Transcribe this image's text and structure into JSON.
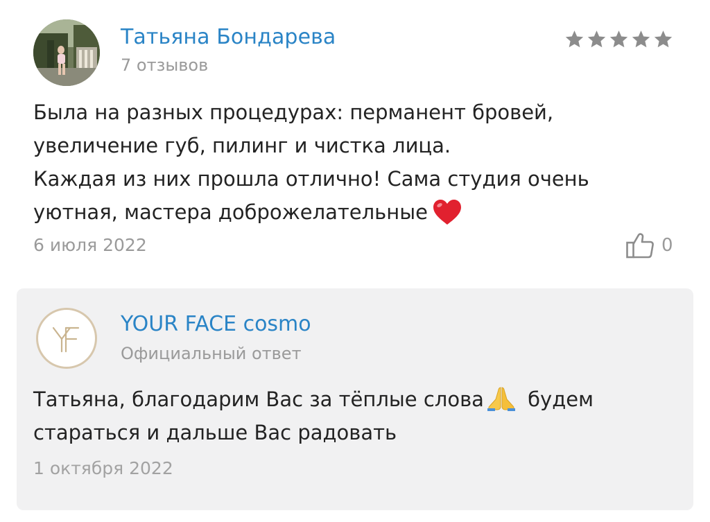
{
  "review": {
    "author": {
      "name": "Татьяна Бондарева",
      "review_count": "7 отзывов",
      "avatar": "photo-avatar"
    },
    "rating": {
      "value": 5,
      "max": 5,
      "star_color": "#8c8c8c"
    },
    "text_lines": [
      "Была на разных процедурах: перманент бровей,",
      "увеличение губ, пилинг и чистка лица.",
      "Каждая из них прошла отлично! Сама студия очень",
      "уютная, мастера доброжелательные"
    ],
    "emoji": "heart-emoji",
    "date": "6 июля 2022",
    "likes": {
      "icon": "thumbs-up-icon",
      "count": "0"
    }
  },
  "response": {
    "company_name": "YOUR FACE cosmo",
    "label": "Официальный ответ",
    "logo": "your-face-logo",
    "text_lines": [
      "Татьяна, благодарим Вас за тёплые слова",
      " будем",
      "стараться и дальше Вас радовать"
    ],
    "emoji": "folded-hands-emoji",
    "date": "1 октября 2022"
  },
  "colors": {
    "link_blue": "#2a84c6",
    "muted_gray": "#9a9a9a",
    "card_background": "#f1f1f2",
    "text": "#232323"
  }
}
